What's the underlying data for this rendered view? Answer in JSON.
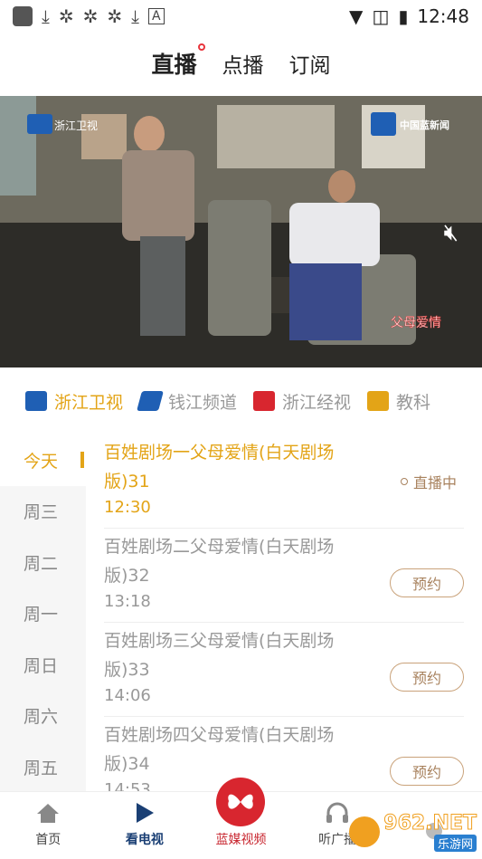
{
  "status_bar": {
    "icons": [
      "app-icon",
      "download-icon",
      "bug-icon",
      "bug-icon",
      "bug-icon",
      "download-icon",
      "a-icon"
    ],
    "time": "12:48"
  },
  "top_tabs": [
    {
      "label": "直播",
      "active": true
    },
    {
      "label": "点播",
      "active": false
    },
    {
      "label": "订阅",
      "active": false
    }
  ],
  "video": {
    "channel_logo_text": "浙江卫视",
    "corner_logo_text": "中国蓝新闻",
    "program_caption": "父母爱情"
  },
  "channels": [
    {
      "label": "浙江卫视",
      "color": "#1f5fb4",
      "active": true
    },
    {
      "label": "钱江频道",
      "color": "#1f5fb4",
      "active": false
    },
    {
      "label": "浙江经视",
      "color": "#d8262f",
      "active": false
    },
    {
      "label": "教科",
      "color": "#e3a417",
      "active": false
    }
  ],
  "days": [
    "今天",
    "周三",
    "周二",
    "周一",
    "周日",
    "周六",
    "周五"
  ],
  "programs": [
    {
      "title": "百姓剧场一父母爱情(白天剧场版)31",
      "time": "12:30",
      "status": "直播中",
      "live": true
    },
    {
      "title": "百姓剧场二父母爱情(白天剧场版)32",
      "time": "13:18",
      "button": "预约",
      "live": false
    },
    {
      "title": "百姓剧场三父母爱情(白天剧场版)33",
      "time": "14:06",
      "button": "预约",
      "live": false
    },
    {
      "title": "百姓剧场四父母爱情(白天剧场版)34",
      "time": "14:53",
      "button": "预约",
      "live": false
    }
  ],
  "bottom_nav": [
    {
      "label": "首页",
      "icon": "home-icon"
    },
    {
      "label": "看电视",
      "icon": "play-icon",
      "active": true
    },
    {
      "label": "蓝媒视频",
      "icon": "butterfly-icon",
      "special": true
    },
    {
      "label": "听广播",
      "icon": "headphones-icon"
    },
    {
      "label": "",
      "icon": "more-icon"
    }
  ],
  "watermark": {
    "text": "962.NET",
    "sub": "乐游网"
  },
  "colors": {
    "accent": "#e3a417",
    "nav_active": "#1a3f74",
    "brand_red": "#d8262f",
    "reserve": "#a8825e"
  }
}
